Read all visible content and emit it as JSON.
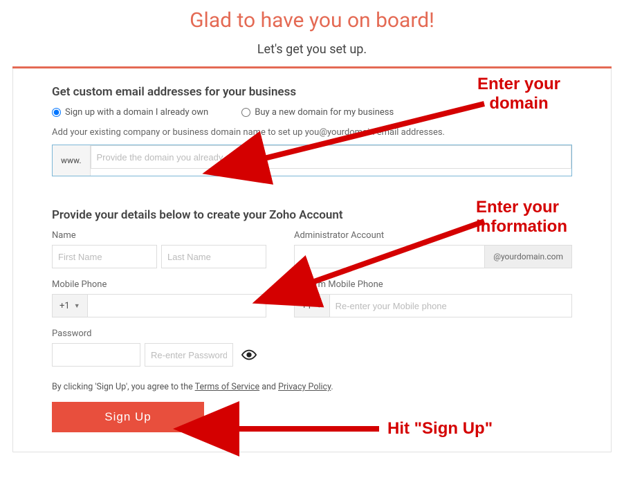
{
  "header": {
    "title": "Glad to have you on board!",
    "subtitle": "Let's get you set up."
  },
  "section1": {
    "title": "Get custom email addresses for your business",
    "radio_own": "Sign up with a domain I already own",
    "radio_buy": "Buy a new domain for my business",
    "helper": "Add your existing company or business domain name to set up you@yourdomain email addresses.",
    "prefix": "www.",
    "placeholder": "Provide the domain you already own"
  },
  "section2": {
    "title": "Provide your details below to create your Zoho Account",
    "name_label": "Name",
    "first_ph": "First Name",
    "last_ph": "Last Name",
    "admin_label": "Administrator Account",
    "admin_suffix": "@yourdomain.com",
    "mobile_label": "Mobile Phone",
    "confirm_mobile_label": "Confirm Mobile Phone",
    "dial": "+1",
    "confirm_mobile_ph": "Re-enter your Mobile phone",
    "password_label": "Password",
    "repw_ph": "Re-enter Password"
  },
  "agree": {
    "prefix": "By clicking 'Sign Up', you agree to the ",
    "tos": "Terms of Service",
    "mid": " and ",
    "pp": "Privacy Policy",
    "suffix": "."
  },
  "signup_label": "Sign Up",
  "annotations": {
    "a1_l1": "Enter your",
    "a1_l2": "domain",
    "a2_l1": "Enter your",
    "a2_l2": "information",
    "a3": "Hit \"Sign Up\""
  }
}
